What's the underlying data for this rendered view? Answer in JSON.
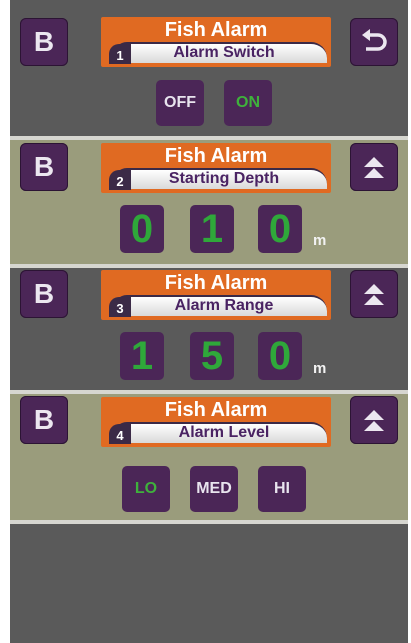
{
  "sections": [
    {
      "back_label": "B",
      "title": "Fish Alarm",
      "number": "1",
      "subtitle": "Alarm Switch",
      "nav_icon": "return-icon",
      "options": [
        "OFF",
        "ON"
      ],
      "selected_option": "ON"
    },
    {
      "back_label": "B",
      "title": "Fish Alarm",
      "number": "2",
      "subtitle": "Starting Depth",
      "nav_icon": "collapse-up-icon",
      "digits": [
        "0",
        "1",
        "0"
      ],
      "unit": "m"
    },
    {
      "back_label": "B",
      "title": "Fish Alarm",
      "number": "3",
      "subtitle": "Alarm Range",
      "nav_icon": "collapse-up-icon",
      "digits": [
        "1",
        "5",
        "0"
      ],
      "unit": "m"
    },
    {
      "back_label": "B",
      "title": "Fish Alarm",
      "number": "4",
      "subtitle": "Alarm Level",
      "nav_icon": "collapse-up-icon",
      "options": [
        "LO",
        "MED",
        "HI"
      ],
      "selected_option": "LO"
    }
  ],
  "colors": {
    "button_purple": "#4b2657",
    "header_orange": "#e06a22",
    "active_green": "#3fb13c",
    "panel_olive": "#9a9c7c",
    "panel_gray": "#5a5a5a"
  }
}
